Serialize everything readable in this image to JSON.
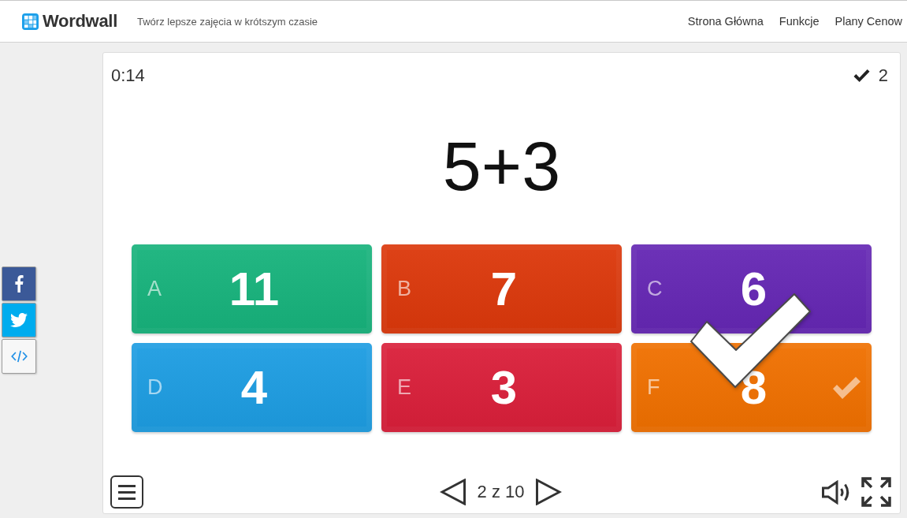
{
  "header": {
    "logo_text": "Wordwall",
    "tagline": "Twórz lepsze zajęcia w krótszym czasie",
    "nav": [
      "Strona Główna",
      "Funkcje",
      "Plany Cenow"
    ]
  },
  "game": {
    "timer": "0:14",
    "score": "2",
    "question": "5+3",
    "answers": [
      {
        "letter": "A",
        "value": "11",
        "color": "#17b37c",
        "selected": false
      },
      {
        "letter": "B",
        "value": "7",
        "color": "#dc380b",
        "selected": false
      },
      {
        "letter": "C",
        "value": "6",
        "color": "#6527b4",
        "selected": false
      },
      {
        "letter": "D",
        "value": "4",
        "color": "#1d9de2",
        "selected": false
      },
      {
        "letter": "E",
        "value": "3",
        "color": "#da1f3a",
        "selected": false
      },
      {
        "letter": "F",
        "value": "8",
        "color": "#f07000",
        "selected": true
      }
    ],
    "pager": "2 z 10"
  }
}
